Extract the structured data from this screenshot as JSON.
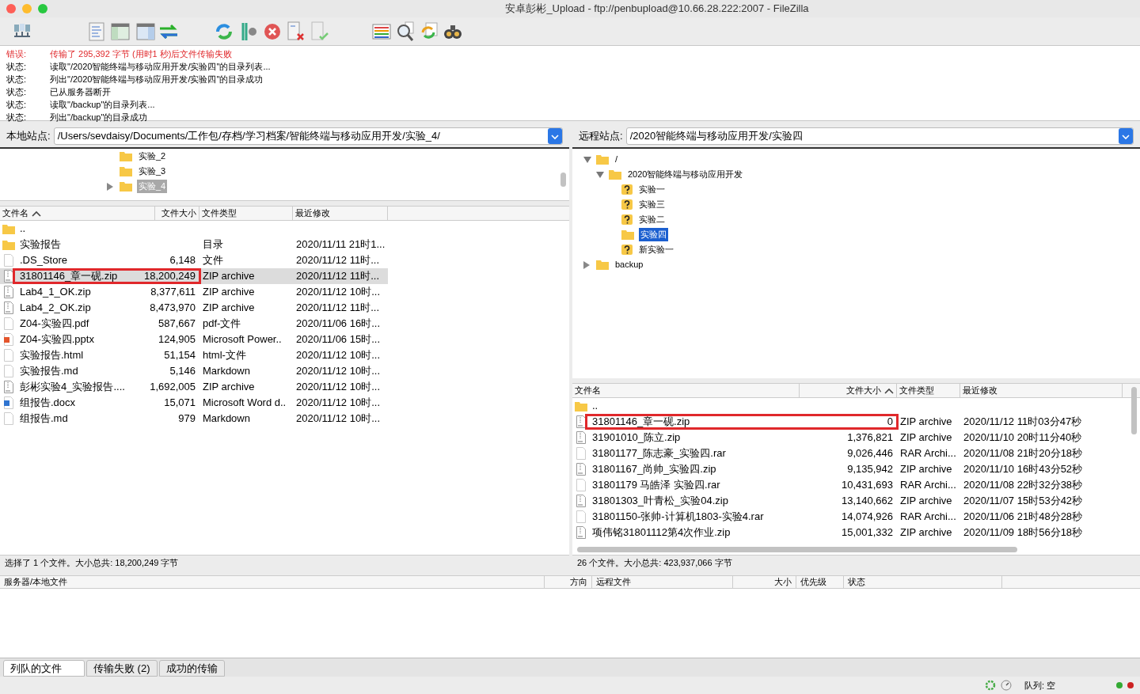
{
  "window": {
    "title": "安卓彭彬_Upload - ftp://penbupload@10.66.28.222:2007 - FileZilla"
  },
  "log": [
    {
      "label": "错误:",
      "message": "传输了 295,392 字节 (用时1 秒)后文件传输失败",
      "kind": "error"
    },
    {
      "label": "状态:",
      "message": "读取\"/2020智能终端与移动应用开发/实验四\"的目录列表...",
      "kind": "status"
    },
    {
      "label": "状态:",
      "message": "列出\"/2020智能终端与移动应用开发/实验四\"的目录成功",
      "kind": "status"
    },
    {
      "label": "状态:",
      "message": "已从服务器断开",
      "kind": "status"
    },
    {
      "label": "状态:",
      "message": "读取\"/backup\"的目录列表...",
      "kind": "status"
    },
    {
      "label": "状态:",
      "message": "列出\"/backup\"的目录成功",
      "kind": "status"
    }
  ],
  "local": {
    "site_label": "本地站点:",
    "path": "/Users/sevdaisy/Documents/工作包/存档/学习档案/智能终端与移动应用开发/实验_4/",
    "tree": [
      {
        "label": "实验_2",
        "selected": false,
        "expander": false
      },
      {
        "label": "实验_3",
        "selected": false,
        "expander": false
      },
      {
        "label": "实验_4",
        "selected": true,
        "expander": true
      }
    ],
    "columns": [
      "文件名",
      "文件大小",
      "文件类型",
      "最近修改"
    ],
    "rows": [
      {
        "kind": "folder",
        "name": "..",
        "selected": false,
        "annotated": false
      },
      {
        "kind": "folder",
        "name": "实验报告",
        "type": "目录",
        "modified": "2020/11/11 21时1...",
        "selected": false,
        "annotated": false
      },
      {
        "kind": "file",
        "name": ".DS_Store",
        "size": "6,148",
        "type": "文件",
        "modified": "2020/11/12 11时...",
        "selected": false,
        "annotated": false
      },
      {
        "kind": "zip",
        "name": "31801146_章一砚.zip",
        "size": "18,200,249",
        "type": "ZIP archive",
        "modified": "2020/11/12 11时...",
        "selected": true,
        "annotated": true
      },
      {
        "kind": "zip",
        "name": "Lab4_1_OK.zip",
        "size": "8,377,611",
        "type": "ZIP archive",
        "modified": "2020/11/12 10时...",
        "selected": false,
        "annotated": false
      },
      {
        "kind": "zip",
        "name": "Lab4_2_OK.zip",
        "size": "8,473,970",
        "type": "ZIP archive",
        "modified": "2020/11/12 11时...",
        "selected": false,
        "annotated": false
      },
      {
        "kind": "file",
        "name": "Z04-实验四.pdf",
        "size": "587,667",
        "type": "pdf-文件",
        "modified": "2020/11/06 16时...",
        "selected": false,
        "annotated": false
      },
      {
        "kind": "slides",
        "name": "Z04-实验四.pptx",
        "size": "124,905",
        "type": "Microsoft Power..",
        "modified": "2020/11/06 15时...",
        "selected": false,
        "annotated": false
      },
      {
        "kind": "file",
        "name": "实验报告.html",
        "size": "51,154",
        "type": "html-文件",
        "modified": "2020/11/12 10时...",
        "selected": false,
        "annotated": false
      },
      {
        "kind": "file",
        "name": "实验报告.md",
        "size": "5,146",
        "type": "Markdown",
        "modified": "2020/11/12 10时...",
        "selected": false,
        "annotated": false
      },
      {
        "kind": "zip",
        "name": "彭彬实验4_实验报告....",
        "size": "1,692,005",
        "type": "ZIP archive",
        "modified": "2020/11/12 10时...",
        "selected": false,
        "annotated": false
      },
      {
        "kind": "doc",
        "name": "组报告.docx",
        "size": "15,071",
        "type": "Microsoft Word d..",
        "modified": "2020/11/12 10时...",
        "selected": false,
        "annotated": false
      },
      {
        "kind": "file",
        "name": "组报告.md",
        "size": "979",
        "type": "Markdown",
        "modified": "2020/11/12 10时...",
        "selected": false,
        "annotated": false
      }
    ],
    "status": "选择了 1 个文件。大小总共: 18,200,249 字节"
  },
  "remote": {
    "site_label": "远程站点:",
    "path": "/2020智能终端与移动应用开发/实验四",
    "tree": [
      {
        "label": "/",
        "kind": "folder",
        "expanded": true,
        "selected": false,
        "children": [
          {
            "label": "2020智能终端与移动应用开发",
            "kind": "folder",
            "expanded": true,
            "selected": false,
            "children": [
              {
                "label": "实验一",
                "kind": "unknown",
                "selected": false
              },
              {
                "label": "实验三",
                "kind": "unknown",
                "selected": false
              },
              {
                "label": "实验二",
                "kind": "unknown",
                "selected": false
              },
              {
                "label": "实验四",
                "kind": "folder",
                "selected": true
              },
              {
                "label": "新实验一",
                "kind": "unknown",
                "selected": false
              }
            ]
          }
        ]
      },
      {
        "label": "backup",
        "kind": "folder",
        "expanded": false,
        "selected": false
      }
    ],
    "columns": [
      "文件名",
      "文件大小",
      "文件类型",
      "最近修改"
    ],
    "rows": [
      {
        "kind": "folder",
        "name": "..",
        "annotated": false
      },
      {
        "kind": "zip",
        "name": "31801146_章一砚.zip",
        "size": "0",
        "type": "ZIP archive",
        "modified": "2020/11/12 11时03分47秒",
        "annotated": true
      },
      {
        "kind": "zip",
        "name": "31901010_陈立.zip",
        "size": "1,376,821",
        "type": "ZIP archive",
        "modified": "2020/11/10 20时11分40秒",
        "annotated": false
      },
      {
        "kind": "file",
        "name": "31801177_陈志豪_实验四.rar",
        "size": "9,026,446",
        "type": "RAR Archi...",
        "modified": "2020/11/08 21时20分18秒",
        "annotated": false
      },
      {
        "kind": "zip",
        "name": "31801167_尚帅_实验四.zip",
        "size": "9,135,942",
        "type": "ZIP archive",
        "modified": "2020/11/10 16时43分52秒",
        "annotated": false
      },
      {
        "kind": "file",
        "name": "31801179 马皓泽 实验四.rar",
        "size": "10,431,693",
        "type": "RAR Archi...",
        "modified": "2020/11/08 22时32分38秒",
        "annotated": false
      },
      {
        "kind": "zip",
        "name": "31801303_叶青松_实验04.zip",
        "size": "13,140,662",
        "type": "ZIP archive",
        "modified": "2020/11/07 15时53分42秒",
        "annotated": false
      },
      {
        "kind": "file",
        "name": "31801150-张帅-计算机1803-实验4.rar",
        "size": "14,074,926",
        "type": "RAR Archi...",
        "modified": "2020/11/06 21时48分28秒",
        "annotated": false
      },
      {
        "kind": "zip",
        "name": "项伟铭31801112第4次作业.zip",
        "size": "15,001,332",
        "type": "ZIP archive",
        "modified": "2020/11/09 18时56分18秒",
        "annotated": false
      }
    ],
    "status": "26 个文件。大小总共: 423,937,066 字节"
  },
  "queue": {
    "columns": [
      "服务器/本地文件",
      "方向",
      "远程文件",
      "大小",
      "优先级",
      "状态"
    ]
  },
  "tabs": [
    {
      "label": "列队的文件",
      "selected": true
    },
    {
      "label": "传输失败 (2)",
      "selected": false
    },
    {
      "label": "成功的传输",
      "selected": false
    }
  ],
  "status_bar": {
    "queue": "队列: 空"
  }
}
